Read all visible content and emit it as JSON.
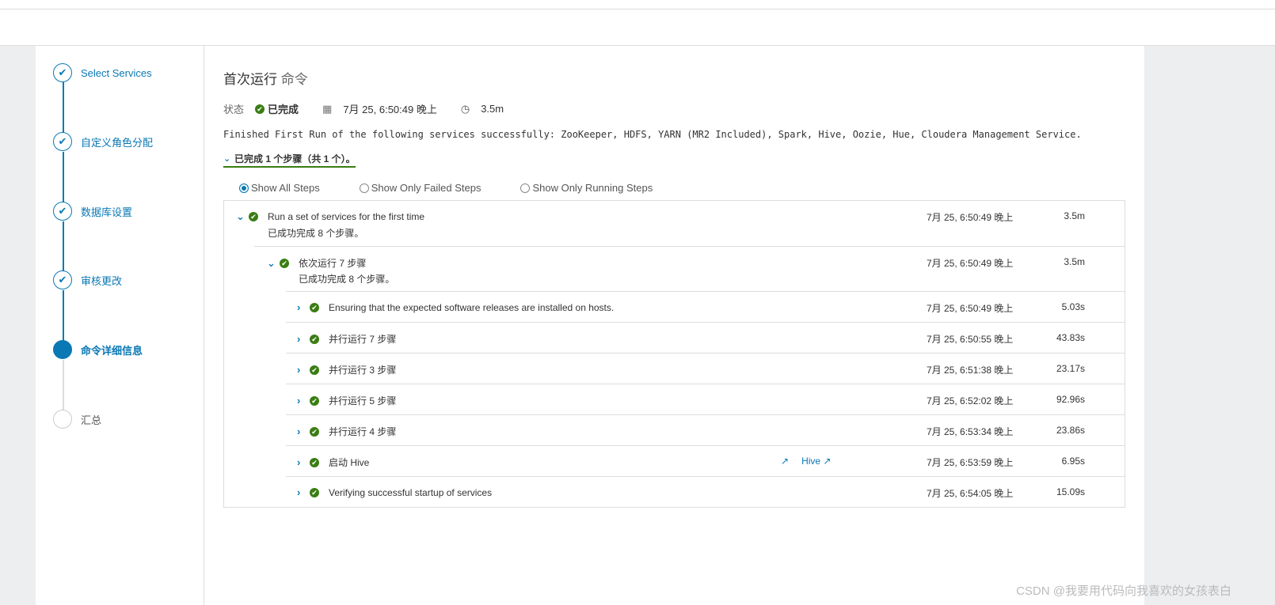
{
  "wizard": {
    "steps": [
      {
        "label": "Select Services",
        "state": "done"
      },
      {
        "label": "自定义角色分配",
        "state": "done"
      },
      {
        "label": "数据库设置",
        "state": "done"
      },
      {
        "label": "审核更改",
        "state": "done"
      },
      {
        "label": "命令详细信息",
        "state": "current"
      },
      {
        "label": "汇总",
        "state": "todo"
      }
    ]
  },
  "command": {
    "title": "首次运行",
    "title_suffix": "命令",
    "status_label": "状态",
    "status": "已完成",
    "start": "7月 25, 6:50:49 晚上",
    "duration": "3.5m",
    "message": "Finished First Run of the following services successfully: ZooKeeper, HDFS, YARN (MR2 Included), Spark, Hive, Oozie, Hue, Cloudera Management Service.",
    "summary": "已完成 1 个步骤（共 1 个）。"
  },
  "filters": [
    "Show All Steps",
    "Show Only Failed Steps",
    "Show Only Running Steps"
  ],
  "filter_selected": 0,
  "steps": [
    {
      "name": "Run a set of services for the first time",
      "sub": "已成功完成  8  个步骤。",
      "time": "7月 25, 6:50:49 晚上",
      "dur": "3.5m"
    },
    {
      "name": "依次运行 7 步骤",
      "sub": "已成功完成  8  个步骤。",
      "time": "7月 25, 6:50:49 晚上",
      "dur": "3.5m"
    },
    {
      "name": "Ensuring that the expected software releases are installed on hosts.",
      "time": "7月 25, 6:50:49 晚上",
      "dur": "5.03s"
    },
    {
      "name": "并行运行 7 步骤",
      "time": "7月 25, 6:50:55 晚上",
      "dur": "43.83s"
    },
    {
      "name": "并行运行 3 步骤",
      "time": "7月 25, 6:51:38 晚上",
      "dur": "23.17s"
    },
    {
      "name": "并行运行 5 步骤",
      "time": "7月 25, 6:52:02 晚上",
      "dur": "92.96s"
    },
    {
      "name": "并行运行 4 步骤",
      "time": "7月 25, 6:53:34 晚上",
      "dur": "23.86s"
    },
    {
      "name": "启动 Hive",
      "link": "Hive",
      "time": "7月 25, 6:53:59 晚上",
      "dur": "6.95s"
    },
    {
      "name": "Verifying successful startup of services",
      "time": "7月 25, 6:54:05 晚上",
      "dur": "15.09s"
    }
  ],
  "watermark": "CSDN @我要用代码向我喜欢的女孩表白",
  "colors": {
    "accent": "#0a78b4",
    "success": "#3a7d13"
  }
}
